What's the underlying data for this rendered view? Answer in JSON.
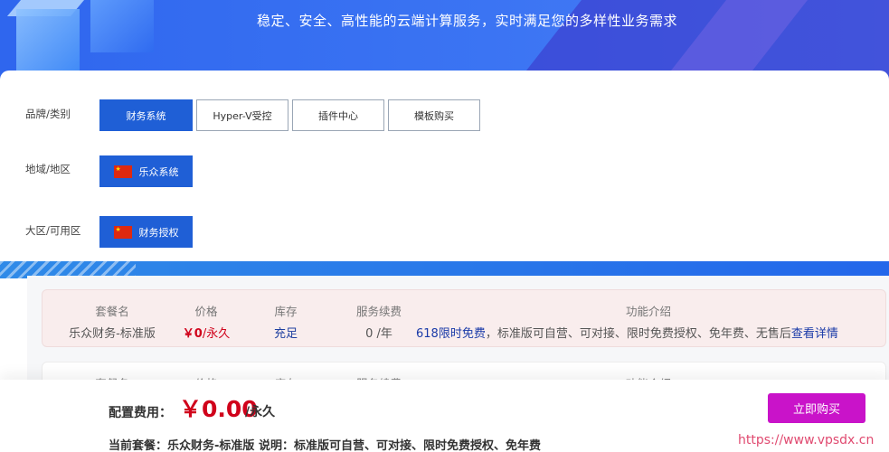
{
  "banner": {
    "tagline": "稳定、安全、高性能的云端计算服务，实时满足您的多样性业务需求"
  },
  "filters": {
    "brand": {
      "label": "品牌/类别",
      "options": [
        {
          "label": "财务系统",
          "active": true
        },
        {
          "label": "Hyper-V受控",
          "active": false
        },
        {
          "label": "插件中心",
          "active": false
        },
        {
          "label": "模板购买",
          "active": false
        }
      ]
    },
    "region": {
      "label": "地域/地区",
      "options": [
        {
          "label": "乐众系统",
          "active": true,
          "flag": "cn-flag-icon"
        }
      ]
    },
    "zone": {
      "label": "大区/可用区",
      "options": [
        {
          "label": "财务授权",
          "active": true,
          "flag": "cn-flag-icon"
        }
      ]
    }
  },
  "table": {
    "headers": [
      "套餐名",
      "价格",
      "库存",
      "服务续费",
      "功能介绍"
    ],
    "rows": [
      {
        "name": "乐众财务-标准版",
        "price": "￥0",
        "price_unit": "/永久",
        "stock": "充足",
        "renewal": "0 /年",
        "features_promo": "618限时免费",
        "features_text": "，标准版可自营、可对接、限时免费授权、免年费、无售后",
        "details_link": "查看详情"
      }
    ]
  },
  "footer": {
    "cost_label": "配置费用：",
    "cost_value": "￥0.00",
    "cost_unit": "/永久",
    "buy_label": "立即购买",
    "plan_prefix": "当前套餐：",
    "plan_name": "乐众财务-标准版",
    "plan_desc": "说明：标准版可自营、可对接、限时免费授权、免年费",
    "watermark": "https://www.vpsdx.cn"
  },
  "colors": {
    "accent": "#1f5fd6",
    "price": "#d0021b",
    "buy_button": "#c913c9"
  }
}
